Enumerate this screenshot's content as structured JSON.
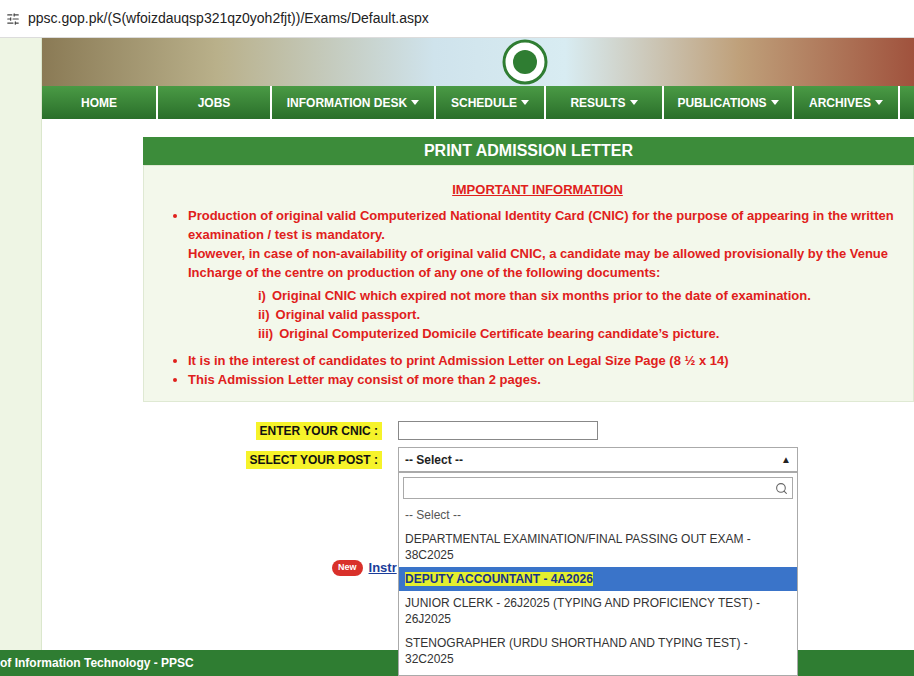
{
  "address_bar": {
    "url": "ppsc.gop.pk/(S(wfoizdauqsp321qz0yoh2fjt))/Exams/Default.aspx"
  },
  "nav": [
    {
      "label": "HOME",
      "dropdown": false
    },
    {
      "label": "JOBS",
      "dropdown": false
    },
    {
      "label": "INFORMATION DESK",
      "dropdown": true
    },
    {
      "label": "SCHEDULE",
      "dropdown": true
    },
    {
      "label": "RESULTS",
      "dropdown": true
    },
    {
      "label": "PUBLICATIONS",
      "dropdown": true
    },
    {
      "label": "ARCHIVES",
      "dropdown": true
    }
  ],
  "panel": {
    "title": "PRINT ADMISSION LETTER",
    "info_heading": "IMPORTANT INFORMATION",
    "bullets": [
      {
        "text": "Production of original valid Computerized National Identity Card (CNIC) for the purpose of appearing in the written examination / test is mandatory.",
        "note": "However, in case of non-availability of original valid CNIC, a candidate may be allowed provisionally by the Venue Incharge of the centre on production of any one of the following documents:",
        "items": [
          {
            "num": "i)",
            "text": "Original CNIC which expired not more than six months prior to the date of examination."
          },
          {
            "num": "ii)",
            "text": "Original valid passport."
          },
          {
            "num": "iii)",
            "text": "Original Computerized Domicile Certificate bearing candidate’s picture."
          }
        ]
      },
      {
        "text": "It is in the interest of candidates to print Admission Letter on Legal Size Page (8 ½ x 14)",
        "note": "",
        "items": []
      },
      {
        "text": "This Admission Letter may consist of more than 2 pages.",
        "note": "",
        "items": []
      }
    ]
  },
  "form": {
    "cnic_label": "ENTER YOUR CNIC :",
    "cnic_label_marked": true,
    "cnic_value": "",
    "post_label": "SELECT YOUR POST :",
    "post_label_marked": true,
    "post_value": "-- Select --",
    "post_arrow": "▲",
    "post_open": true
  },
  "dropdown": {
    "search_value": "",
    "options": [
      {
        "label": "-- Select --",
        "selected": false,
        "marked": false
      },
      {
        "label": "DEPARTMENTAL EXAMINATION/FINAL PASSING OUT EXAM - 38C2025",
        "selected": false,
        "marked": false
      },
      {
        "label": "DEPUTY ACCOUNTANT - 4A2026",
        "selected": true,
        "marked": true
      },
      {
        "label": "JUNIOR CLERK - 26J2025 (TYPING AND PROFICIENCY TEST) - 26J2025",
        "selected": false,
        "marked": false
      },
      {
        "label": "STENOGRAPHER (URDU SHORTHAND AND TYPING TEST) - 32C2025",
        "selected": false,
        "marked": false
      }
    ]
  },
  "instructions": {
    "badge": "New",
    "link": "Instr"
  },
  "footer": {
    "text": "of Information Technology - PPSC"
  }
}
